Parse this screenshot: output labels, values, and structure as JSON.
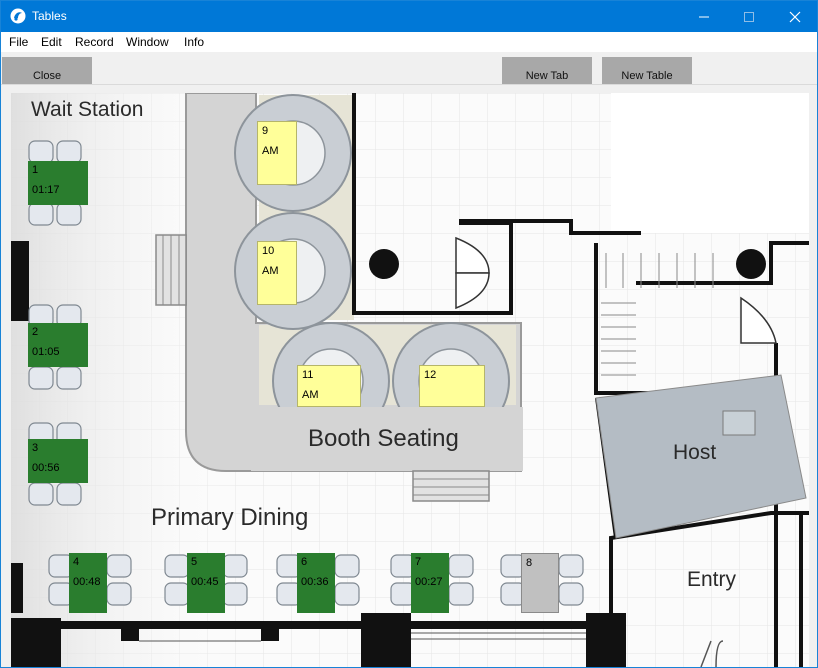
{
  "window": {
    "title": "Tables"
  },
  "menu": [
    "File",
    "Edit",
    "Record",
    "Window",
    "Info"
  ],
  "toolbar": {
    "close": "Close",
    "new_tab": "New Tab",
    "new_table": "New Table"
  },
  "areas": {
    "wait_station": "Wait Station",
    "booth_seating": "Booth Seating",
    "primary_dining": "Primary Dining",
    "host": "Host",
    "entry": "Entry"
  },
  "colors": {
    "titlebar": "#0078d7",
    "occupied": "#2a7d2e",
    "reserved": "#ffff99",
    "free": "#c0c0c0"
  },
  "tables": [
    {
      "number": "1",
      "info": "01:17",
      "status": "occupied"
    },
    {
      "number": "2",
      "info": "01:05",
      "status": "occupied"
    },
    {
      "number": "3",
      "info": "00:56",
      "status": "occupied"
    },
    {
      "number": "4",
      "info": "00:48",
      "status": "occupied"
    },
    {
      "number": "5",
      "info": "00:45",
      "status": "occupied"
    },
    {
      "number": "6",
      "info": "00:36",
      "status": "occupied"
    },
    {
      "number": "7",
      "info": "00:27",
      "status": "occupied"
    },
    {
      "number": "8",
      "info": "",
      "status": "free"
    },
    {
      "number": "9",
      "info": "AM",
      "status": "reserved"
    },
    {
      "number": "10",
      "info": "AM",
      "status": "reserved"
    },
    {
      "number": "11",
      "info": "AM",
      "status": "reserved"
    },
    {
      "number": "12",
      "info": "",
      "status": "reserved"
    }
  ]
}
